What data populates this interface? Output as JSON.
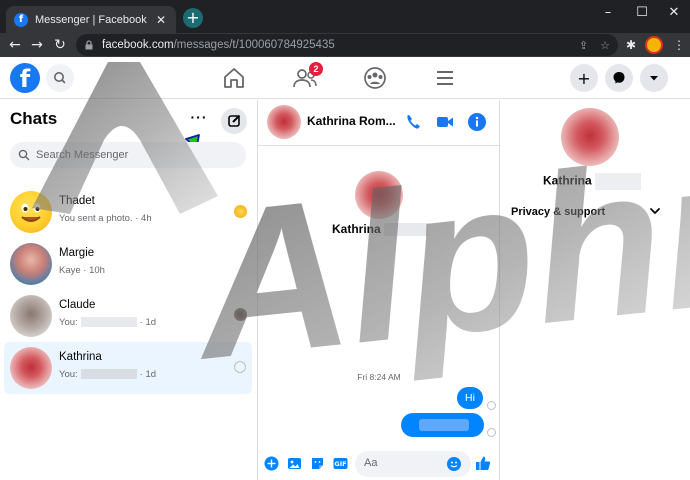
{
  "browser": {
    "tab_title": "Messenger | Facebook",
    "url_host": "facebook.com",
    "url_path": "/messages/t/100060784925435"
  },
  "topbar": {
    "notification_count": "2"
  },
  "sidebar": {
    "title": "Chats",
    "more_label": "···",
    "search_placeholder": "Search Messenger",
    "chats": [
      {
        "name": "Thadet",
        "preview": "You sent a photo. · 4h",
        "active": false
      },
      {
        "name": "Margie",
        "preview": "Kaye · 10h",
        "active": false
      },
      {
        "name": "Claude",
        "preview_prefix": "You:",
        "time": "· 1d",
        "active": false
      },
      {
        "name": "Kathrina",
        "preview_prefix": "You:",
        "time": "· 1d",
        "active": true
      }
    ]
  },
  "conversation": {
    "header_name": "Kathrina Rom...",
    "profile_name": "Kathrina",
    "timestamp": "Fri 8:24 AM",
    "messages": [
      {
        "text": "Hi",
        "from_me": true
      }
    ],
    "composer_placeholder": "Aa"
  },
  "info_panel": {
    "name": "Kathrina",
    "privacy_label": "Privacy & support"
  },
  "watermark_text": "Alphr",
  "colors": {
    "facebook_blue": "#1877f2",
    "messenger_blue": "#0084ff",
    "badge_red": "#e41e3f"
  }
}
